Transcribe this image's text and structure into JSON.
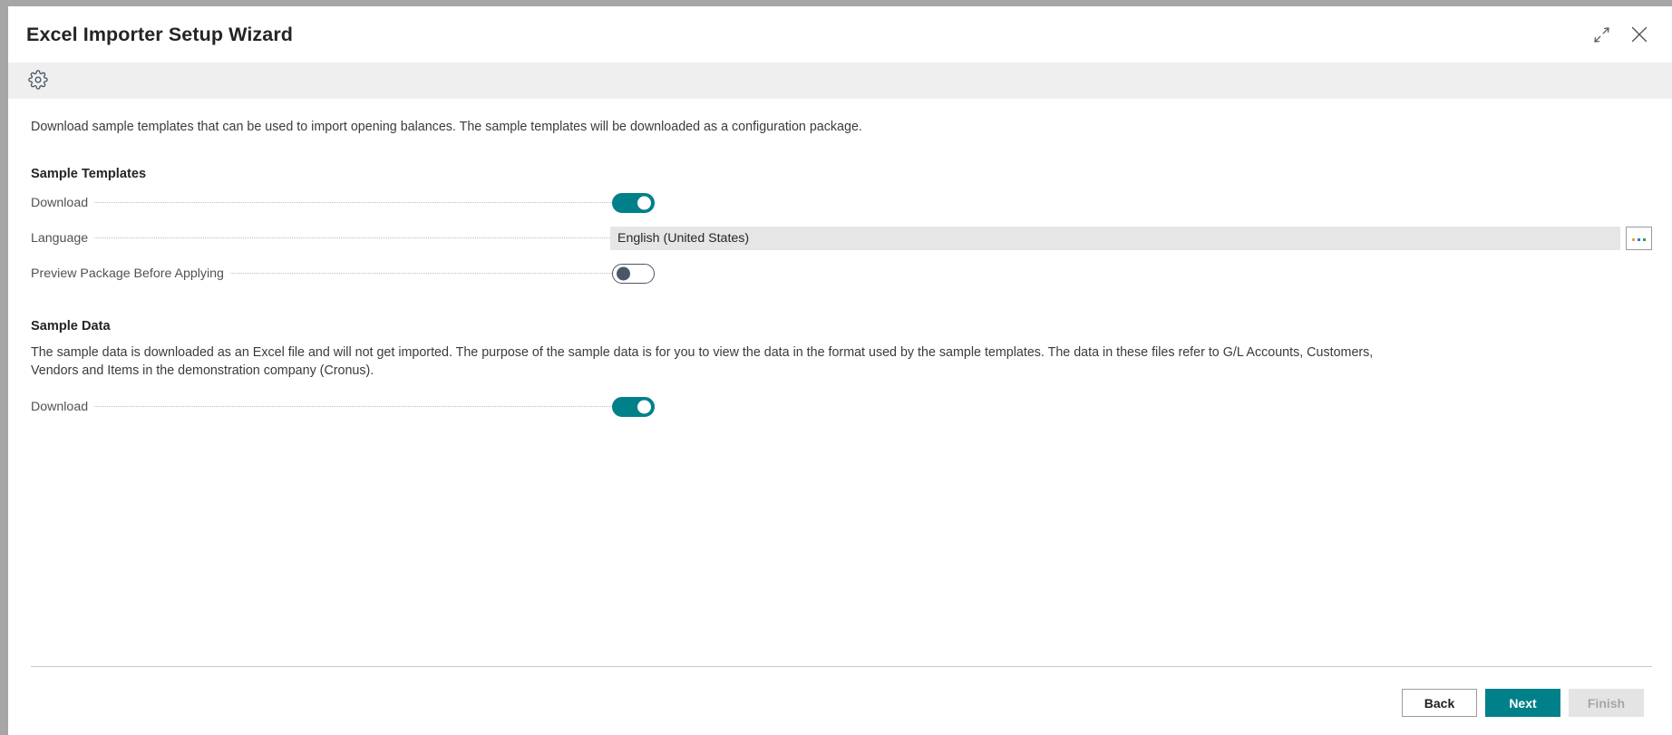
{
  "window": {
    "title": "Excel Importer Setup Wizard",
    "restore_down_icon": "shrink-diagonal-icon",
    "close_icon": "close-icon"
  },
  "ribbon": {
    "settings_icon": "gear-icon"
  },
  "content": {
    "intro": "Download sample templates that can be used to import opening balances. The sample templates will be downloaded as a configuration package.",
    "sections": [
      {
        "title": "Sample Templates",
        "fields": [
          {
            "label": "Download",
            "type": "toggle",
            "value": "on"
          },
          {
            "label": "Language",
            "type": "lookup",
            "value": "English (United States)",
            "assist_icon": "ellipsis-assist-icon"
          },
          {
            "label": "Preview Package Before Applying",
            "type": "toggle",
            "value": "off"
          }
        ]
      },
      {
        "title": "Sample Data",
        "description": "The sample data is downloaded as an Excel file and will not get imported. The purpose of the sample data is for you to view the data in the format used by the sample templates. The data in these files refer to G/L Accounts, Customers, Vendors and Items in the demonstration company (Cronus).",
        "fields": [
          {
            "label": "Download",
            "type": "toggle",
            "value": "on"
          }
        ]
      }
    ]
  },
  "footer": {
    "back_label": "Back",
    "next_label": "Next",
    "finish_label": "Finish"
  },
  "colors": {
    "accent_teal": "#008089",
    "ribbon_background": "#efefef",
    "field_background": "#e6e6e6",
    "disabled_background": "#e4e4e4",
    "window_border": "#a6a6a6"
  }
}
